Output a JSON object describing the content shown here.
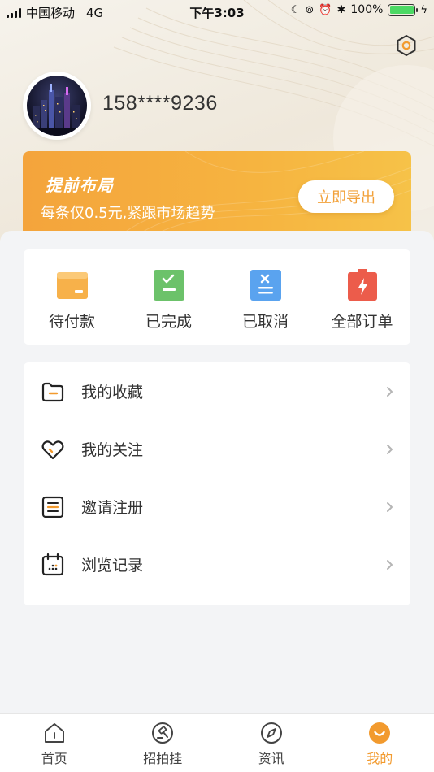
{
  "status_bar": {
    "carrier": "中国移动",
    "network": "4G",
    "time": "下午3:03",
    "battery": "100%",
    "battery_level": 1.0
  },
  "profile": {
    "phone": "158****9236",
    "avatar_icon": "city-night-avatar"
  },
  "promo": {
    "title": "提前布局",
    "subtitle": "每条仅0.5元,紧跟市场趋势",
    "button_label": "立即导出"
  },
  "orders": [
    {
      "label": "待付款",
      "icon": "wallet-icon",
      "color": "#f7b14a"
    },
    {
      "label": "已完成",
      "icon": "check-list-icon",
      "color": "#6cc26a"
    },
    {
      "label": "已取消",
      "icon": "cancel-list-icon",
      "color": "#5aa3ef"
    },
    {
      "label": "全部订单",
      "icon": "battery-bolt-icon",
      "color": "#ec5c4b"
    }
  ],
  "menu": [
    {
      "label": "我的收藏",
      "icon": "folder-icon"
    },
    {
      "label": "我的关注",
      "icon": "heart-icon"
    },
    {
      "label": "邀请注册",
      "icon": "document-icon"
    },
    {
      "label": "浏览记录",
      "icon": "calendar-icon"
    }
  ],
  "tabs": [
    {
      "label": "首页",
      "icon": "home-icon"
    },
    {
      "label": "招拍挂",
      "icon": "gavel-icon"
    },
    {
      "label": "资讯",
      "icon": "compass-icon"
    },
    {
      "label": "我的",
      "icon": "smile-icon",
      "active": true
    }
  ],
  "colors": {
    "accent": "#f29a2e",
    "promo_start": "#f4a43c",
    "promo_end": "#f6c248"
  }
}
